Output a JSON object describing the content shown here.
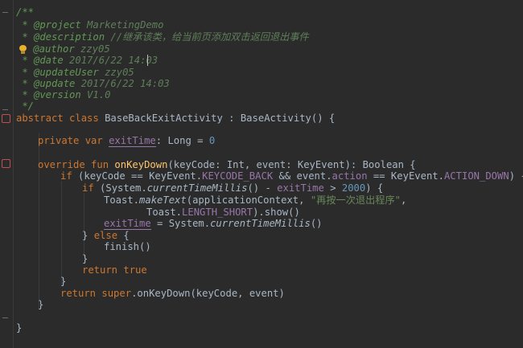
{
  "editor": {
    "lines": {
      "l1": "/**",
      "l2a": " * @project",
      "l2b": " MarketingDemo",
      "l3a": " * @description",
      "l3b": " //继承该类，给当前页添加双击返回退出事件",
      "l4a": " @author",
      "l4b": " zzy05",
      "l5a": " * @date",
      "l5b": " 2017/6/22 14:03",
      "l6a": " * @updateUser",
      "l6b": " zzy05",
      "l7a": " * @update",
      "l7b": " 2017/6/22 14:03",
      "l8a": " * @version",
      "l8b": " V1.0",
      "l9": " */",
      "l10_kw": "abstract class",
      "l10_name": " BaseBackExitActivity : ",
      "l10_super": "BaseActivity",
      "l10_tail": "() {",
      "l11_kw": "private var ",
      "l11_prop": "exitTime",
      "l11_type": ": Long = ",
      "l11_num": "0",
      "l12_kw": "override fun ",
      "l12_fn": "onKeyDown",
      "l12_p1": "(keyCode",
      "l12_t1": ": Int, ",
      "l12_p2": "event",
      "l12_t2": ": KeyEvent): Boolean {",
      "l13_kw": "if ",
      "l13_a": "(keyCode == KeyEvent.",
      "l13_const1": "KEYCODE_BACK",
      "l13_b": " && event.",
      "l13_prop": "action",
      "l13_c": " == KeyEvent.",
      "l13_const2": "ACTION_DOWN",
      "l13_d": ") {",
      "l14_kw": "if ",
      "l14_a": "(System.",
      "l14_fn": "currentTimeMillis",
      "l14_b": "() - ",
      "l14_prop": "exitTime",
      "l14_c": " > ",
      "l14_num": "2000",
      "l14_d": ") {",
      "l15_a": "Toast.",
      "l15_fn": "makeText",
      "l15_b": "(applicationContext, ",
      "l15_str": "\"再按一次退出程序\"",
      "l15_c": ",",
      "l16_a": "Toast.",
      "l16_const": "LENGTH_SHORT",
      "l16_b": ").show()",
      "l17_prop": "exitTime",
      "l17_a": " = System.",
      "l17_fn": "currentTimeMillis",
      "l17_b": "()",
      "l18_a": "} ",
      "l18_kw": "else",
      "l18_b": " {",
      "l19_fn": "finish",
      "l19_a": "()",
      "l20": "}",
      "l21": "return true",
      "l22": "}",
      "l23_kw": "return super",
      "l23_a": ".",
      "l23_fn": "onKeyDown",
      "l23_b": "(keyCode, event)",
      "l24": "}",
      "l26": "}"
    }
  },
  "colors": {
    "background": "#2b2b2b",
    "comment": "#629755",
    "keyword": "#cc7832",
    "string": "#6a8759",
    "number": "#6897bb",
    "property": "#9876aa",
    "function": "#ffc66d",
    "text": "#a9b7c6"
  },
  "icons": {
    "gutter_fold": "fold-icon",
    "bulb": "lightbulb-icon",
    "override": "override-icon"
  }
}
